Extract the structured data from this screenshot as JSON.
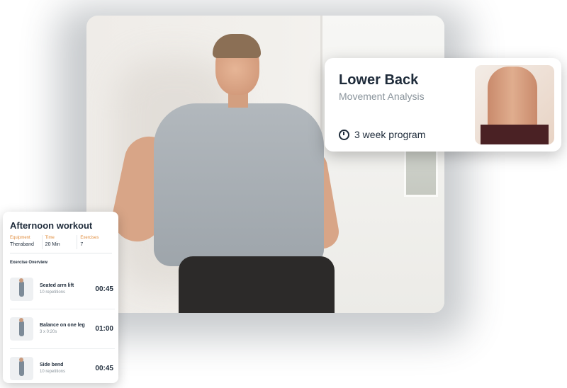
{
  "hero": {
    "image_icon": "man-leaning-against-wall-photo"
  },
  "program_card": {
    "title": "Lower Back",
    "subtitle": "Movement Analysis",
    "duration": "3 week program",
    "duration_icon": "clock-icon",
    "thumbnail_icon": "lower-back-photo"
  },
  "workout_card": {
    "title": "Afternoon workout",
    "stats": [
      {
        "label": "Equipment",
        "value": "Theraband"
      },
      {
        "label": "Time",
        "value": "20 Min"
      },
      {
        "label": "Exercises",
        "value": "7"
      }
    ],
    "overview_heading": "Exercise Overview",
    "exercises": [
      {
        "name": "Seated arm lift",
        "detail": "10 repetitions",
        "time": "00:45"
      },
      {
        "name": "Balance on one leg",
        "detail": "3 x 0:20s",
        "time": "01:00"
      },
      {
        "name": "Side bend",
        "detail": "10 repetitions",
        "time": "00:45"
      }
    ]
  },
  "colors": {
    "accent": "#e08c3c",
    "text_primary": "#1e2b3a",
    "text_secondary": "#8a949c"
  }
}
